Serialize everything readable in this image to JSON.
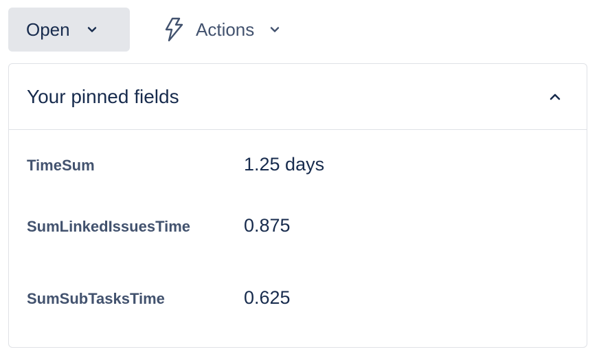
{
  "toolbar": {
    "status_label": "Open",
    "actions_label": "Actions"
  },
  "icons": {
    "status_chevron": "chevron-down-icon",
    "actions_icon": "lightning-bolt-icon",
    "actions_chevron": "chevron-down-icon",
    "collapse": "chevron-up-icon"
  },
  "panel": {
    "title": "Your pinned fields",
    "fields": [
      {
        "label": "TimeSum",
        "value": "1.25 days"
      },
      {
        "label": "SumLinkedIssuesTime",
        "value": "0.875"
      },
      {
        "label": "SumSubTasksTime",
        "value": "0.625"
      }
    ]
  },
  "colors": {
    "button_bg": "#e4e6ea",
    "text_primary": "#172b4d",
    "text_secondary": "#42526e",
    "border": "#dfe1e6"
  }
}
